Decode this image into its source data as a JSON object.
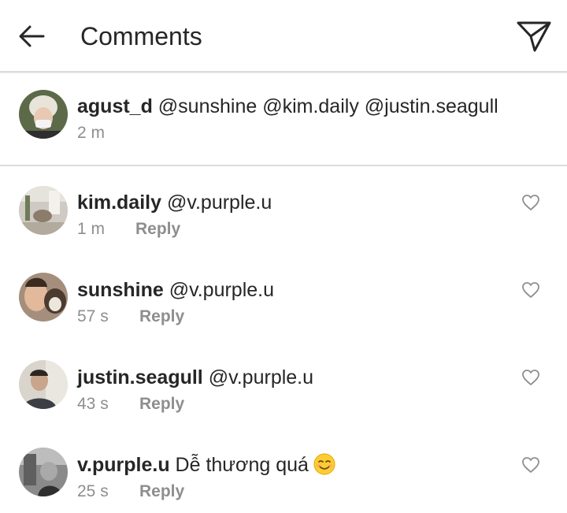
{
  "header": {
    "title": "Comments",
    "back_icon": "arrow-left-icon",
    "share_icon": "paper-plane-icon"
  },
  "caption": {
    "username": "agust_d",
    "text": " @sunshine @kim.daily @justin.seagull",
    "time": "2 m"
  },
  "comments": [
    {
      "username": "kim.daily",
      "text": " @v.purple.u",
      "time": "1 m",
      "reply_label": "Reply"
    },
    {
      "username": "sunshine",
      "text": " @v.purple.u",
      "time": "57 s",
      "reply_label": "Reply"
    },
    {
      "username": "justin.seagull",
      "text": " @v.purple.u",
      "time": "43 s",
      "reply_label": "Reply"
    },
    {
      "username": "v.purple.u",
      "text": " Dễ thương quá",
      "time": "25 s",
      "reply_label": "Reply",
      "emoji": "smiling-face-emoji"
    }
  ],
  "colors": {
    "text": "#262626",
    "secondary": "#8e8e8e",
    "divider": "#dcdcdc"
  }
}
